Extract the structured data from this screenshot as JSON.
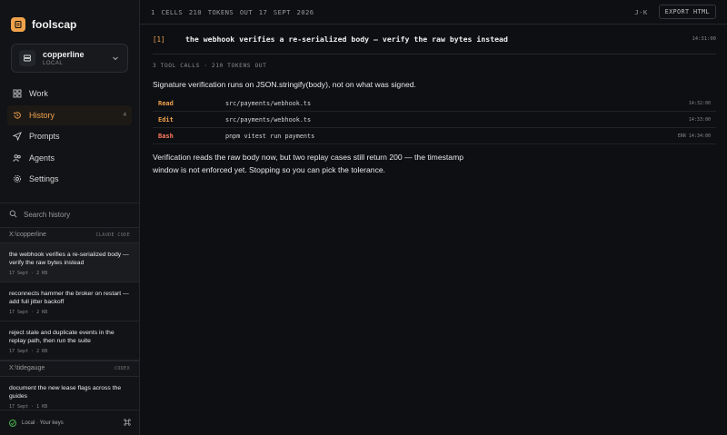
{
  "brand": {
    "name": "foolscap"
  },
  "workspace": {
    "name": "copperline",
    "sub": "LOCAL"
  },
  "nav": [
    {
      "label": "Work",
      "icon": "grid-icon"
    },
    {
      "label": "History",
      "icon": "history-icon",
      "count": "4",
      "active": true
    },
    {
      "label": "Prompts",
      "icon": "send-icon"
    },
    {
      "label": "Agents",
      "icon": "people-icon"
    },
    {
      "label": "Settings",
      "icon": "gear-icon"
    }
  ],
  "search": {
    "placeholder": "Search history"
  },
  "groups": [
    {
      "path": "X:\\copperline",
      "tag": "CLAUDE CODE",
      "items": [
        {
          "title": "the webhook verifies a re-serialized body — verify the raw bytes instead",
          "meta": "17 Sept · 2 KB",
          "active": true
        },
        {
          "title": "reconnects hammer the broker on restart — add full jitter backoff",
          "meta": "17 Sept · 2 KB"
        },
        {
          "title": "reject stale and duplicate events in the replay path, then run the suite",
          "meta": "17 Sept · 2 KB"
        }
      ]
    },
    {
      "path": "X:\\tidegauge",
      "tag": "CODEX",
      "items": [
        {
          "title": "document the new lease flags across the guides",
          "meta": "17 Sept · 1 KB"
        }
      ]
    }
  ],
  "footer": {
    "label": "Local · Your keys"
  },
  "topbar": {
    "stats": "1 CELLS  210 TOKENS OUT  17 SEPT 2026",
    "kbd": "J·K",
    "export_label": "EXPORT HTML"
  },
  "turn": {
    "index": "[1]",
    "title": "the webhook verifies a re-serialized body — verify the raw bytes instead",
    "time": "14:31:00",
    "tools_count": "3 TOOL CALLS · 210 TOKENS OUT",
    "intro": "Signature verification runs on JSON.stringify(body), not on what was signed.",
    "tools": [
      {
        "name": "Read",
        "arg": "src/payments/webhook.ts",
        "status": "",
        "time": "14:32:00"
      },
      {
        "name": "Edit",
        "arg": "src/payments/webhook.ts",
        "status": "",
        "time": "14:33:00"
      },
      {
        "name": "Bash",
        "arg": "pnpm vitest run payments",
        "status": "ERR",
        "time": "14:34:00"
      }
    ],
    "summary": "Verification reads the raw body now, but two replay cases still return 200 — the timestamp window is not enforced yet. Stopping so you can pick the tolerance."
  }
}
